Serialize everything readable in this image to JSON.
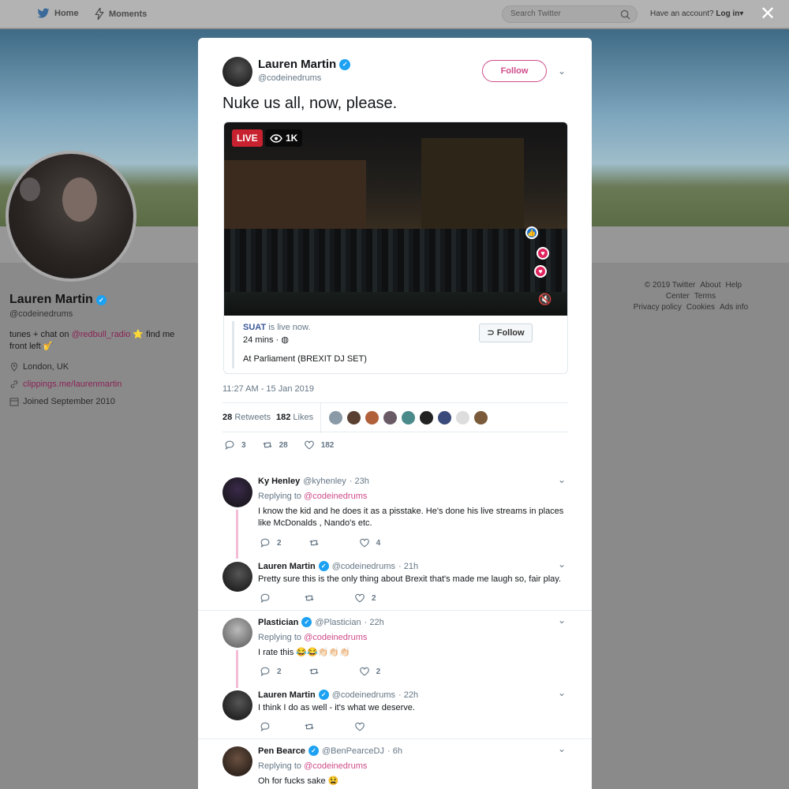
{
  "topbar": {
    "home": "Home",
    "moments": "Moments",
    "search_placeholder": "Search Twitter",
    "have_account": "Have an account?",
    "login": "Log in"
  },
  "profile": {
    "name": "Lauren Martin",
    "handle": "@codeinedrums",
    "bio_prefix": "tunes + chat on ",
    "bio_link": "@redbull_radio",
    "bio_suffix": " ⭐ find me front left 🎷",
    "location": "London, UK",
    "website": "clippings.me/laurenmartin",
    "joined": "Joined September 2010"
  },
  "footer": [
    "© 2019 Twitter",
    "About",
    "Help Center",
    "Terms",
    "Privacy policy",
    "Cookies",
    "Ads info"
  ],
  "tweet": {
    "name": "Lauren Martin",
    "handle": "@codeinedrums",
    "follow_label": "Follow",
    "text": "Nuke us all, now, please.",
    "live_label": "LIVE",
    "viewers": "1K",
    "card_user": "SUAT",
    "card_status": " is live now.",
    "card_time": "24 mins ·",
    "card_title": "At Parliament (BREXIT DJ SET)",
    "card_follow": "Follow",
    "timestamp": "11:27 AM - 15 Jan 2019",
    "retweets_count": "28",
    "retweets_label": "Retweets",
    "likes_count": "182",
    "likes_label": "Likes",
    "reply_count": "3",
    "retweet_count": "28",
    "like_count": "182",
    "liker_colors": [
      "#8a9aa6",
      "#5a4030",
      "#b0603a",
      "#6a5a66",
      "#4a8a8a",
      "#222222",
      "#3a4a7a",
      "#dddddd",
      "#7a5a3a"
    ]
  },
  "replies": [
    {
      "name": "Ky Henley",
      "handle": "@kyhenley",
      "time": "· 23h",
      "replying_prefix": "Replying to ",
      "replying_to": "@codeinedrums",
      "text": "I know the kid and he does it as a pisstake. He's done his live streams in places like McDonalds , Nando's etc.",
      "replies": "2",
      "retweets": "",
      "likes": "4"
    },
    {
      "name": "Lauren Martin",
      "handle": "@codeinedrums",
      "time": "· 21h",
      "text": "Pretty sure this is the only thing about Brexit that's made me laugh so, fair play.",
      "replies": "",
      "retweets": "",
      "likes": "2"
    },
    {
      "name": "Plastician",
      "handle": "@Plastician",
      "time": "· 22h",
      "replying_prefix": "Replying to ",
      "replying_to": "@codeinedrums",
      "text": "I rate this 😂😂👏🏻👏🏻👏🏻",
      "replies": "2",
      "retweets": "",
      "likes": "2"
    },
    {
      "name": "Lauren Martin",
      "handle": "@codeinedrums",
      "time": "· 22h",
      "text": "I think I do as well - it's what we deserve.",
      "replies": "",
      "retweets": "",
      "likes": ""
    },
    {
      "name": "Pen Bearce",
      "handle": "@BenPearceDJ",
      "time": "· 6h",
      "replying_prefix": "Replying to ",
      "replying_to": "@codeinedrums",
      "text": "Oh for fucks sake 😫"
    }
  ]
}
